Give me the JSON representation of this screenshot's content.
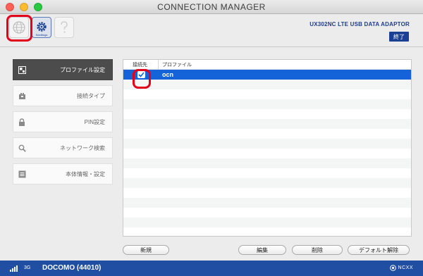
{
  "window": {
    "title": "CONNECTION MANAGER",
    "colors": {
      "close": "#fe5f57",
      "minimize": "#febc2e",
      "zoom": "#28c840"
    }
  },
  "toolbar": {
    "tools": [
      {
        "icon": "globe-icon",
        "caption": ""
      },
      {
        "icon": "gear-icon",
        "caption": "Seettings"
      },
      {
        "icon": "help-icon",
        "caption": ""
      }
    ],
    "device_name": "UX302NC LTE USB DATA ADAPTOR",
    "exit_label": "終了"
  },
  "sidebar": {
    "items": [
      {
        "label": "プロファイル設定",
        "icon": "profile-icon",
        "active": true
      },
      {
        "label": "接続タイプ",
        "icon": "connection-type-icon",
        "active": false
      },
      {
        "label": "PIN設定",
        "icon": "lock-icon",
        "active": false
      },
      {
        "label": "ネットワーク検索",
        "icon": "search-icon",
        "active": false
      },
      {
        "label": "本体情報・設定",
        "icon": "info-list-icon",
        "active": false
      }
    ]
  },
  "table": {
    "columns": [
      "接続先",
      "プロファイル"
    ],
    "rows": [
      {
        "selected": true,
        "connected": true,
        "profile": "ocn"
      }
    ]
  },
  "actions": {
    "new_label": "新規",
    "edit_label": "編集",
    "delete_label": "削除",
    "default_clear_label": "デフォルト解除"
  },
  "status": {
    "network": "3G",
    "carrier": "DOCOMO (44010)",
    "brand": "NCXX"
  },
  "colors": {
    "accent": "#1b3f94",
    "selection": "#1463d8",
    "highlight": "#e2001a",
    "statusbar": "#1f4ea3"
  }
}
